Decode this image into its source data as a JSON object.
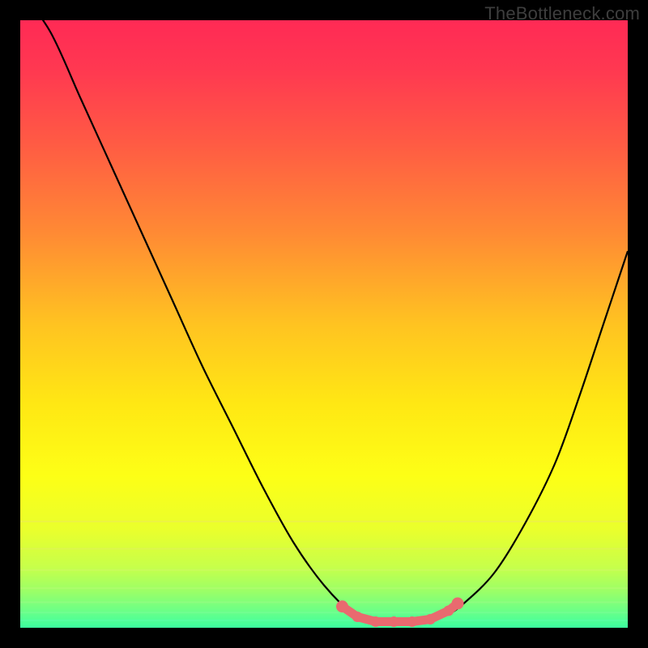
{
  "watermark": "TheBottleneck.com",
  "colors": {
    "frame": "#000000",
    "curve_stroke": "#000000",
    "marker_fill": "#e96a6f",
    "gradient_stops": [
      {
        "offset": 0.0,
        "hex": "#ff2a55"
      },
      {
        "offset": 0.08,
        "hex": "#ff3851"
      },
      {
        "offset": 0.2,
        "hex": "#ff5a44"
      },
      {
        "offset": 0.35,
        "hex": "#ff8a34"
      },
      {
        "offset": 0.5,
        "hex": "#ffc321"
      },
      {
        "offset": 0.63,
        "hex": "#ffe714"
      },
      {
        "offset": 0.75,
        "hex": "#fdff16"
      },
      {
        "offset": 0.84,
        "hex": "#e9ff2d"
      },
      {
        "offset": 0.9,
        "hex": "#c7ff4a"
      },
      {
        "offset": 0.94,
        "hex": "#9bff67"
      },
      {
        "offset": 0.97,
        "hex": "#6fff85"
      },
      {
        "offset": 1.0,
        "hex": "#3cffa0"
      }
    ],
    "band_lines": [
      {
        "y_frac": 0.825,
        "hex": "#ece75e",
        "w": 2
      },
      {
        "y_frac": 0.87,
        "hex": "#e0f05f",
        "w": 2
      },
      {
        "y_frac": 0.905,
        "hex": "#cff866",
        "w": 2
      },
      {
        "y_frac": 0.935,
        "hex": "#b7fc74",
        "w": 2
      },
      {
        "y_frac": 0.958,
        "hex": "#9afd86",
        "w": 2
      },
      {
        "y_frac": 0.975,
        "hex": "#7bfe97",
        "w": 2
      },
      {
        "y_frac": 0.988,
        "hex": "#5affab",
        "w": 2
      }
    ]
  },
  "chart_data": {
    "type": "line",
    "title": "",
    "xlabel": "",
    "ylabel": "",
    "xlim": [
      0,
      1
    ],
    "ylim": [
      0,
      1
    ],
    "series": [
      {
        "name": "bottleneck-curve",
        "x": [
          0.0,
          0.05,
          0.1,
          0.15,
          0.2,
          0.25,
          0.3,
          0.35,
          0.4,
          0.45,
          0.5,
          0.55,
          0.58,
          0.62,
          0.66,
          0.7,
          0.73,
          0.78,
          0.83,
          0.88,
          0.92,
          0.96,
          1.0
        ],
        "y": [
          1.05,
          0.98,
          0.87,
          0.76,
          0.65,
          0.54,
          0.43,
          0.33,
          0.23,
          0.14,
          0.07,
          0.02,
          0.01,
          0.01,
          0.01,
          0.02,
          0.04,
          0.09,
          0.17,
          0.27,
          0.38,
          0.5,
          0.62
        ]
      }
    ],
    "markers": {
      "name": "optimal-range",
      "x": [
        0.53,
        0.555,
        0.585,
        0.615,
        0.645,
        0.675,
        0.705,
        0.72
      ],
      "y": [
        0.035,
        0.018,
        0.01,
        0.01,
        0.01,
        0.014,
        0.028,
        0.04
      ]
    }
  }
}
